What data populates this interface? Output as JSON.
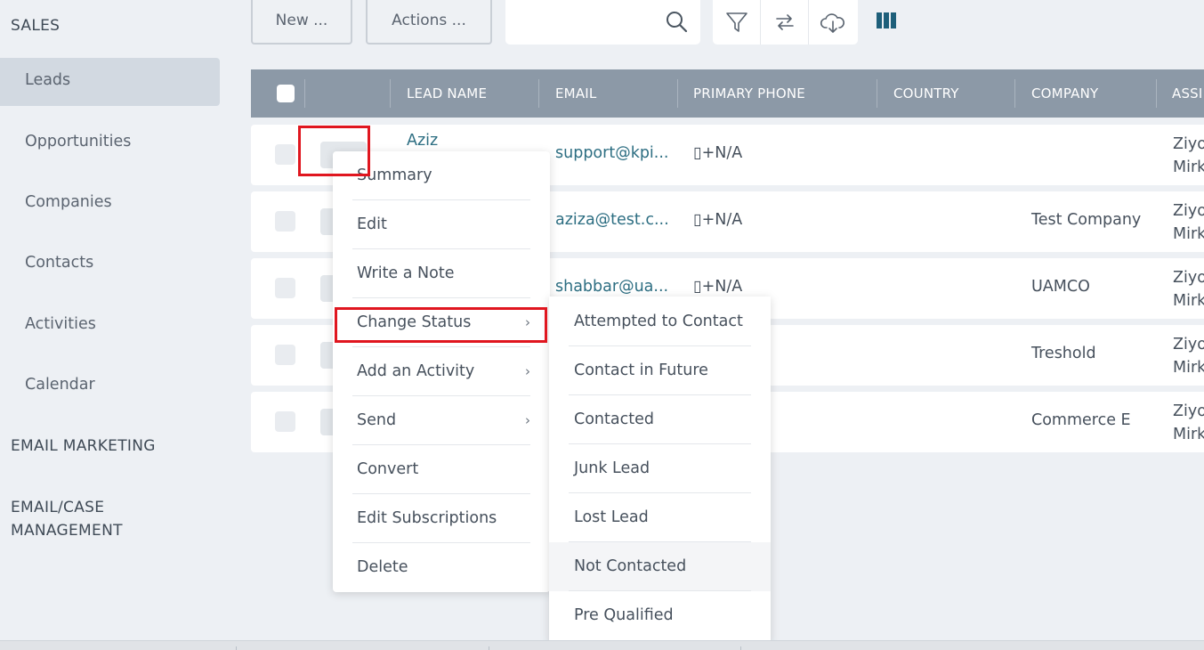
{
  "sidebar": {
    "sales_header": "SALES",
    "items": [
      "Leads",
      "Opportunities",
      "Companies",
      "Contacts",
      "Activities",
      "Calendar"
    ],
    "email_marketing": "EMAIL MARKETING",
    "email_case_1": "EMAIL/CASE",
    "email_case_2": "MANAGEMENT"
  },
  "toolbar": {
    "new_label": "New ...",
    "actions_label": "Actions ...",
    "search_value": ""
  },
  "table": {
    "headers": [
      "LEAD NAME",
      "EMAIL",
      "PRIMARY PHONE",
      "COUNTRY",
      "COMPANY",
      "ASSI"
    ],
    "rows": [
      {
        "name": "Aziz",
        "email": "support@kpi...",
        "phone": "▯+N/A",
        "country": "",
        "company": "",
        "assign1": "Ziyo",
        "assign2": "Mirk"
      },
      {
        "name": "",
        "email": "aziza@test.c...",
        "phone": "▯+N/A",
        "country": "",
        "company": "Test Company",
        "assign1": "Ziyo",
        "assign2": "Mirk"
      },
      {
        "name": "",
        "email": "shabbar@ua...",
        "phone": "▯+N/A",
        "country": "",
        "company": "UAMCO",
        "assign1": "Ziyo",
        "assign2": "Mirk"
      },
      {
        "name": "",
        "email": "",
        "phone": "",
        "country": "",
        "company": "Treshold",
        "assign1": "Ziyo",
        "assign2": "Mirk"
      },
      {
        "name": "",
        "email": "",
        "phone": "",
        "country": "",
        "company": "Commerce E",
        "assign1": "Ziyo",
        "assign2": "Mirk"
      }
    ]
  },
  "context_menu": {
    "items": [
      "Summary",
      "Edit",
      "Write a Note",
      "Change Status",
      "Add an Activity",
      "Send",
      "Convert",
      "Edit Subscriptions",
      "Delete"
    ]
  },
  "status_submenu": {
    "items": [
      "Attempted to Contact",
      "Contact in Future",
      "Contacted",
      "Junk Lead",
      "Lost Lead",
      "Not Contacted",
      "Pre Qualified"
    ]
  },
  "colors": {
    "header_bg": "#8c99a7",
    "link": "#2d6e82",
    "highlight": "#e0161f",
    "columns_icon": "#1e5f7a"
  }
}
